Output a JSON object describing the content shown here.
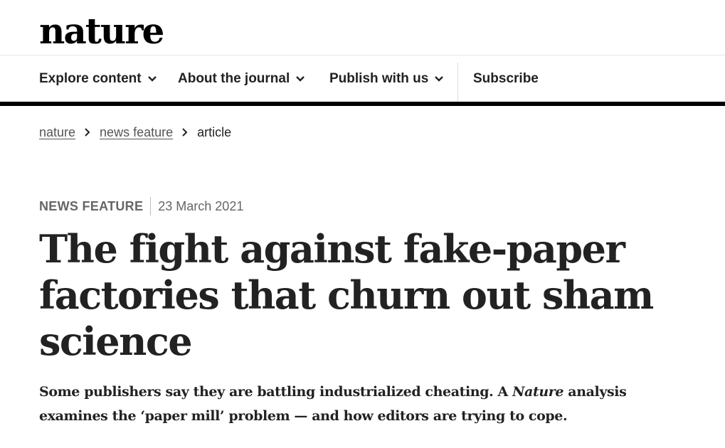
{
  "site": {
    "logo": "nature"
  },
  "nav": {
    "items": [
      {
        "label": "Explore content",
        "has_dropdown": true
      },
      {
        "label": "About the journal",
        "has_dropdown": true
      },
      {
        "label": "Publish with us",
        "has_dropdown": true
      },
      {
        "label": "Subscribe",
        "has_dropdown": false
      }
    ]
  },
  "breadcrumb": {
    "items": [
      "nature",
      "news feature"
    ],
    "current": "article"
  },
  "article": {
    "type": "NEWS FEATURE",
    "date": "23 March 2021",
    "title": "The fight against fake-paper factories that churn out sham science",
    "standfirst_part1": "Some publishers say they are battling industrialized cheating. A ",
    "standfirst_italic": "Nature",
    "standfirst_part2": " analysis examines the ‘paper mill’ problem — and how editors are trying to cope."
  },
  "colors": {
    "text": "#222222",
    "muted": "#666666",
    "rule": "#000000"
  }
}
